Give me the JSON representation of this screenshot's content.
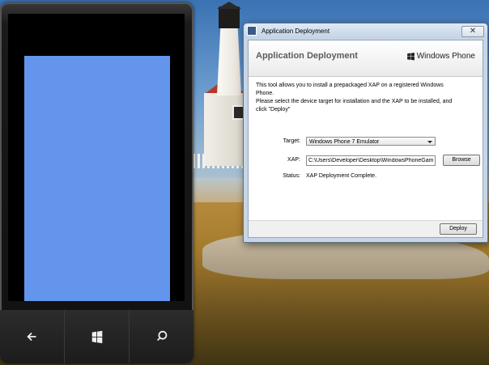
{
  "dialog": {
    "window_title": "Application Deployment",
    "close_glyph": "✕",
    "header_title": "Application Deployment",
    "brand": "Windows Phone",
    "description": [
      "This tool allows you to install a prepackaged XAP on a registered Windows",
      "Phone.",
      "Please select the device target for installation and the XAP to be installed, and",
      "click \"Deploy\""
    ],
    "target_label": "Target:",
    "target_value": "Windows Phone 7 Emulator",
    "xap_label": "XAP:",
    "xap_value": "C:\\Users\\Developer\\Desktop\\WindowsPhoneGam",
    "browse_label": "Browse",
    "status_label": "Status:",
    "status_value": "XAP Deployment Complete.",
    "deploy_label": "Deploy"
  },
  "phone": {
    "screen_color": "#6495ed",
    "buttons": [
      "back-icon",
      "windows-icon",
      "search-icon"
    ]
  }
}
